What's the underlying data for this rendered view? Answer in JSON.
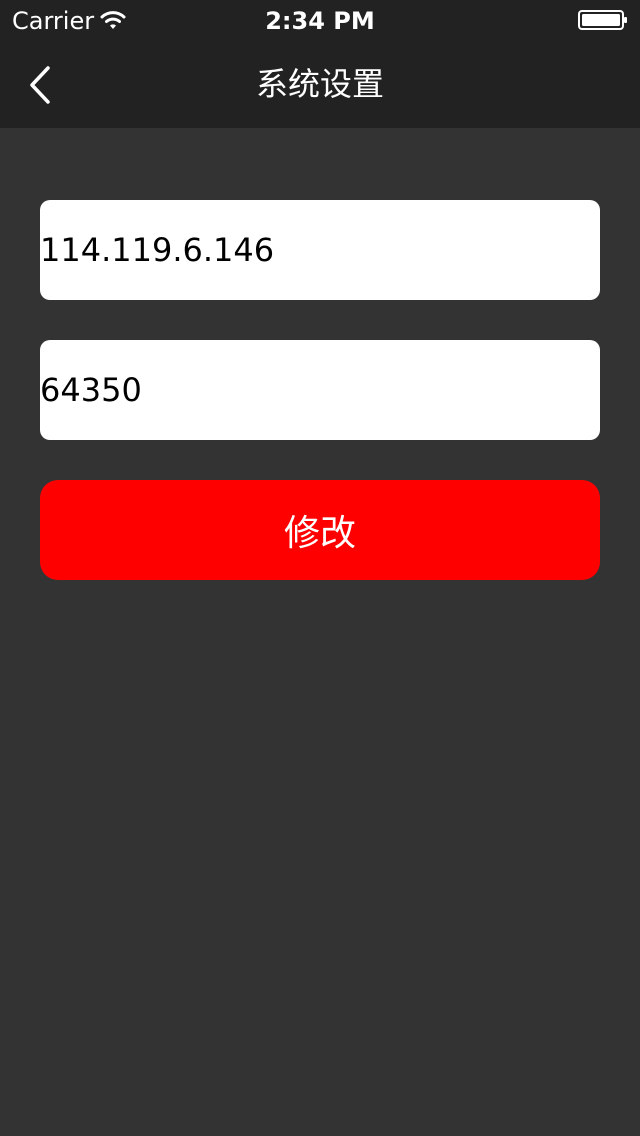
{
  "status_bar": {
    "carrier": "Carrier",
    "time": "2:34 PM",
    "wifi_icon": "wifi-icon",
    "battery_icon": "battery-icon"
  },
  "nav": {
    "title": "系统设置",
    "back_icon": "chevron-left-icon"
  },
  "form": {
    "ip_value": "114.119.6.146",
    "port_value": "64350",
    "submit_label": "修改"
  },
  "colors": {
    "background": "#333333",
    "bar": "#222222",
    "accent": "#ff0000"
  }
}
